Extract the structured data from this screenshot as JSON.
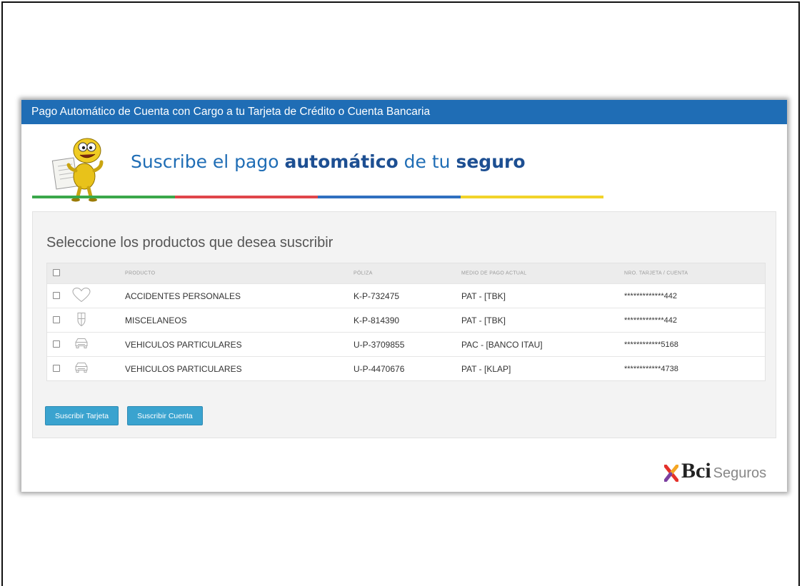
{
  "window": {
    "title": "Pago Automático de Cuenta con Cargo a tu Tarjeta de Crédito o Cuenta Bancaria"
  },
  "banner": {
    "headline_part1": "Suscribe el pago ",
    "headline_bold1": "automático",
    "headline_part2": " de tu ",
    "headline_bold2": "seguro",
    "stripe_colors": [
      "#3aa84a",
      "#e0464a",
      "#2f6fbf",
      "#f2d32a"
    ]
  },
  "panel": {
    "title": "Seleccione los productos que desea suscribir",
    "table": {
      "headers": {
        "producto": "PRODUCTO",
        "poliza": "PÓLIZA",
        "medio": "MEDIO DE PAGO ACTUAL",
        "nro": "NRO. TARJETA / CUENTA"
      },
      "rows": [
        {
          "icon": "heart-icon",
          "producto": "ACCIDENTES PERSONALES",
          "poliza": "K-P-732475",
          "medio": "PAT - [TBK]",
          "nro": "*************442"
        },
        {
          "icon": "shield-icon",
          "producto": "MISCELANEOS",
          "poliza": "K-P-814390",
          "medio": "PAT - [TBK]",
          "nro": "*************442"
        },
        {
          "icon": "car-icon",
          "producto": "VEHICULOS PARTICULARES",
          "poliza": "U-P-3709855",
          "medio": "PAC - [BANCO ITAU]",
          "nro": "************5168"
        },
        {
          "icon": "car-icon",
          "producto": "VEHICULOS PARTICULARES",
          "poliza": "U-P-4470676",
          "medio": "PAT - [KLAP]",
          "nro": "************4738"
        }
      ]
    },
    "buttons": {
      "tarjeta": "Suscribir Tarjeta",
      "cuenta": "Suscribir Cuenta"
    }
  },
  "logo": {
    "brand": "Bci",
    "sub": "Seguros"
  }
}
